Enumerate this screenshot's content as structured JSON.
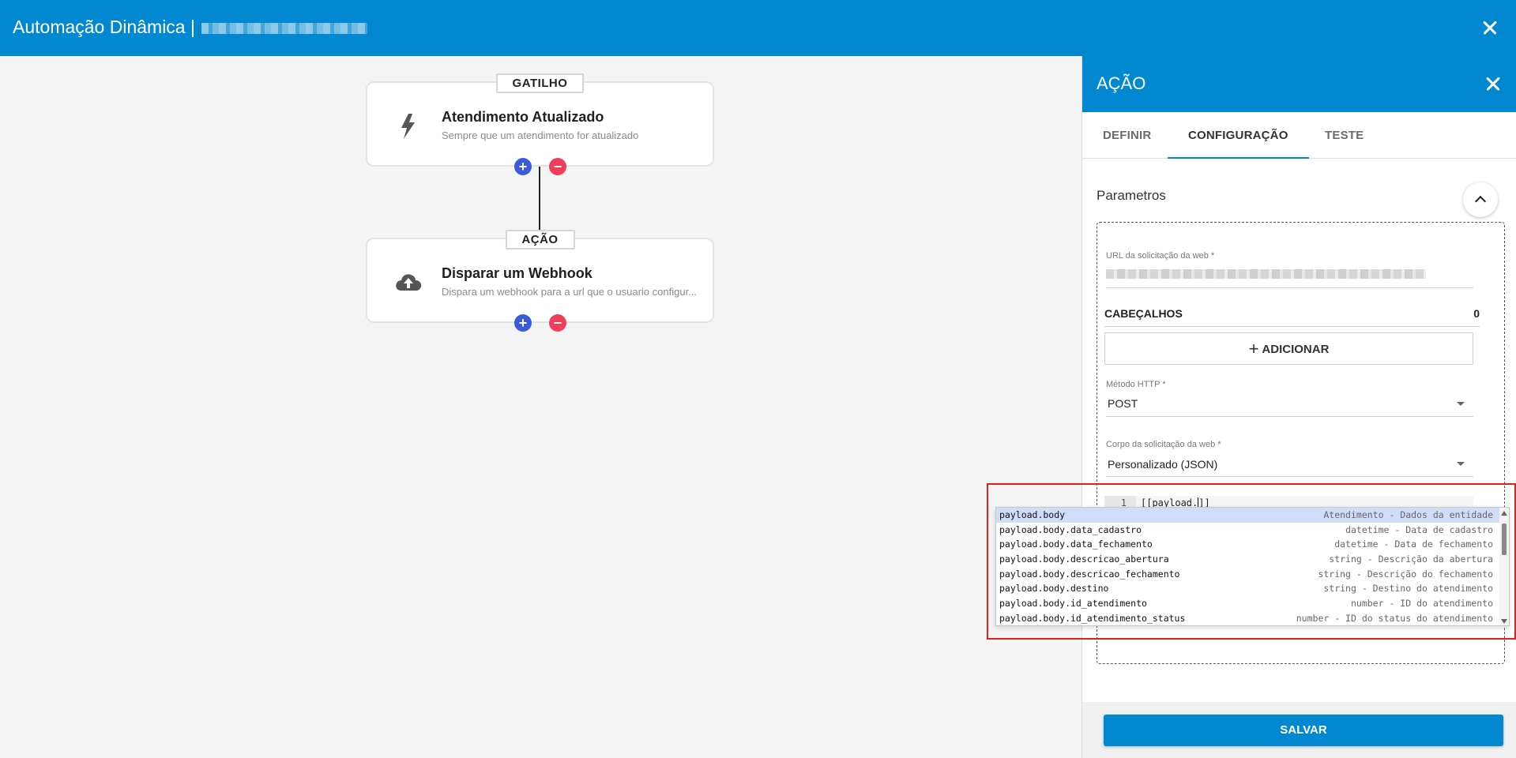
{
  "app": {
    "title": "Automação Dinâmica |"
  },
  "trigger_card": {
    "badge": "GATILHO",
    "title": "Atendimento Atualizado",
    "subtitle": "Sempre que um atendimento for atualizado",
    "icon": "lightning-bolt-icon",
    "add_label": "+",
    "remove_label": "−"
  },
  "action_card": {
    "badge": "AÇÃO",
    "title": "Disparar um Webhook",
    "subtitle": "Dispara um webhook para a url que o usuario configur...",
    "icon": "cloud-upload-icon",
    "add_label": "+",
    "remove_label": "−"
  },
  "panel": {
    "title": "AÇÃO",
    "tabs": [
      {
        "label": "DEFINIR"
      },
      {
        "label": "CONFIGURAÇÃO"
      },
      {
        "label": "TESTE"
      }
    ],
    "active_tab": "CONFIGURAÇÃO",
    "section_title": "Parametros",
    "url_field": {
      "label": "URL da solicitação da web *"
    },
    "headers": {
      "label": "CABEÇALHOS",
      "count": "0",
      "add_button": "ADICIONAR"
    },
    "http_method": {
      "label": "Método HTTP *",
      "value": "POST"
    },
    "body": {
      "label": "Corpo da solicitação da web *",
      "value": "Personalizado (JSON)"
    },
    "editor": {
      "line_number": "1",
      "code_before_cursor": "[[payload.",
      "code_after_cursor": "]]"
    },
    "save_button": "SALVAR"
  },
  "suggestions": [
    {
      "name": "payload.body",
      "detail": "Atendimento - Dados da entidade"
    },
    {
      "name": "payload.body.data_cadastro",
      "detail": "datetime - Data de cadastro"
    },
    {
      "name": "payload.body.data_fechamento",
      "detail": "datetime - Data de fechamento"
    },
    {
      "name": "payload.body.descricao_abertura",
      "detail": "string - Descrição da abertura"
    },
    {
      "name": "payload.body.descricao_fechamento",
      "detail": "string - Descrição do fechamento"
    },
    {
      "name": "payload.body.destino",
      "detail": "string - Destino do atendimento"
    },
    {
      "name": "payload.body.id_atendimento",
      "detail": "number - ID do atendimento"
    },
    {
      "name": "payload.body.id_atendimento_status",
      "detail": "number - ID do status do atendimento"
    }
  ],
  "colors": {
    "primary": "#0288d1",
    "add": "#3b5bdb",
    "remove": "#f03e5a",
    "highlight_frame": "#e02020"
  }
}
